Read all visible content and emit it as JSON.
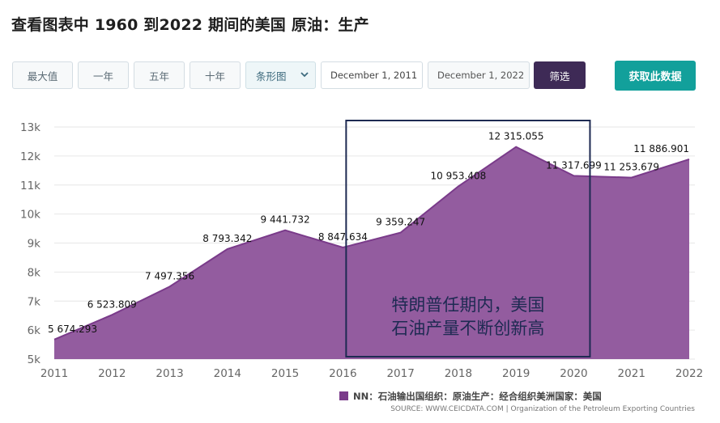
{
  "page": {
    "title": "查看图表中 1960 到2022 期间的美国 原油：生产"
  },
  "toolbar": {
    "ranges": [
      "最大值",
      "一年",
      "五年",
      "十年"
    ],
    "chart_type_select": "条形图",
    "start_date": "December 1, 2011",
    "end_date": "December 1, 2022",
    "filter_label": "筛选",
    "get_data_label": "获取此数据"
  },
  "colors": {
    "area": "#935c9f",
    "line": "#7a3b8a",
    "annotation_box": "#1e2a52",
    "filter_button": "#3e2a56",
    "get_data_button": "#12a09b"
  },
  "chart_data": {
    "type": "area",
    "categories": [
      "2011",
      "2012",
      "2013",
      "2014",
      "2015",
      "2016",
      "2017",
      "2018",
      "2019",
      "2020",
      "2021",
      "2022"
    ],
    "series": [
      {
        "name": "NN：石油输出国组织：原油生产：经合组织美洲国家：美国",
        "values": [
          5674.293,
          6523.809,
          7497.356,
          8793.342,
          9441.732,
          8847.634,
          9359.247,
          10953.408,
          12315.055,
          11317.699,
          11253.679,
          11886.901
        ],
        "labels": [
          "5 674.293",
          "6 523.809",
          "7 497.356",
          "8 793.342",
          "9 441.732",
          "8 847.634",
          "9 359.247",
          "10 953.408",
          "12 315.055",
          "11 317.699",
          "11 253.679",
          "11 886.901"
        ]
      }
    ],
    "ylim": [
      5000,
      13000
    ],
    "yticks": [
      5000,
      6000,
      7000,
      8000,
      9000,
      10000,
      11000,
      12000,
      13000
    ],
    "ytick_labels": [
      "5k",
      "6k",
      "7k",
      "8k",
      "9k",
      "10k",
      "11k",
      "12k",
      "13k"
    ],
    "grid": true,
    "legend_position": "bottom-right",
    "annotation": {
      "lines": [
        "特朗普任期内，美国",
        "石油产量不断创新高"
      ],
      "from": "2016",
      "to": "2020"
    },
    "source": "SOURCE: WWW.CEICDATA.COM | Organization of the Petroleum Exporting Countries"
  }
}
